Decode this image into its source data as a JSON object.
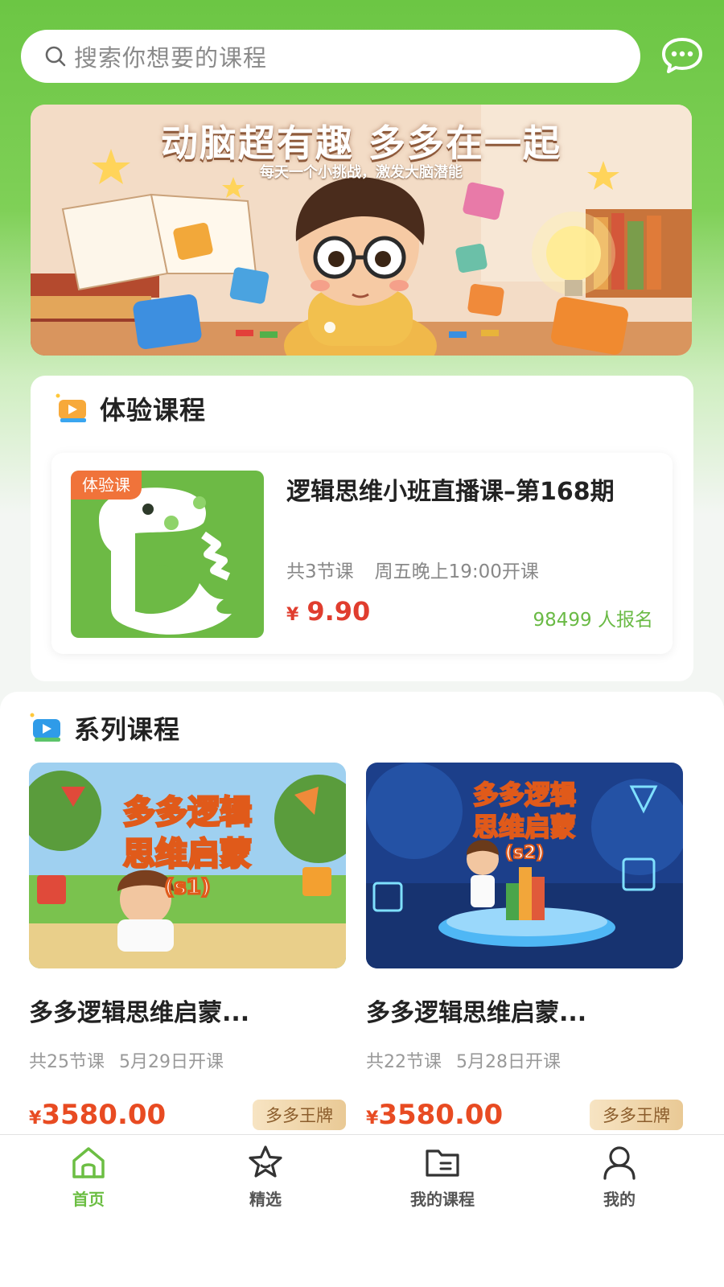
{
  "header": {
    "search_placeholder": "搜索你想要的课程"
  },
  "banner": {
    "title": "动脑超有趣 多多在一起",
    "subtitle": "每天一个小挑战，激发大脑潜能"
  },
  "trial_section": {
    "title": "体验课程",
    "course": {
      "tag": "体验课",
      "title": "逻辑思维小班直播课–第168期",
      "lessons": "共3节课",
      "schedule": "周五晚上19:00开课",
      "currency": "¥",
      "price": "9.90",
      "enrolled": "98499 人报名"
    }
  },
  "series_section": {
    "title": "系列课程",
    "courses": [
      {
        "image_title_1": "多多逻辑",
        "image_title_2": "思维启蒙",
        "image_badge": "(s1)",
        "title": "多多逻辑思维启蒙...",
        "lessons": "共25节课",
        "start": "5月29日开课",
        "currency": "¥",
        "price": "3580.00",
        "badge": "多多王牌"
      },
      {
        "image_title_1": "多多逻辑",
        "image_title_2": "思维启蒙",
        "image_badge": "(s2)",
        "title": "多多逻辑思维启蒙...",
        "lessons": "共22节课",
        "start": "5月28日开课",
        "currency": "¥",
        "price": "3580.00",
        "badge": "多多王牌"
      }
    ]
  },
  "bottom_nav": [
    {
      "label": "首页",
      "icon": "home-icon",
      "active": true
    },
    {
      "label": "精选",
      "icon": "star-icon",
      "active": false
    },
    {
      "label": "我的课程",
      "icon": "folder-icon",
      "active": false
    },
    {
      "label": "我的",
      "icon": "user-icon",
      "active": false
    }
  ],
  "colors": {
    "brand_green": "#6cc644",
    "price_red": "#e03d2e",
    "trial_tag_orange": "#f0733a",
    "enrolled_green": "#6aba45"
  }
}
